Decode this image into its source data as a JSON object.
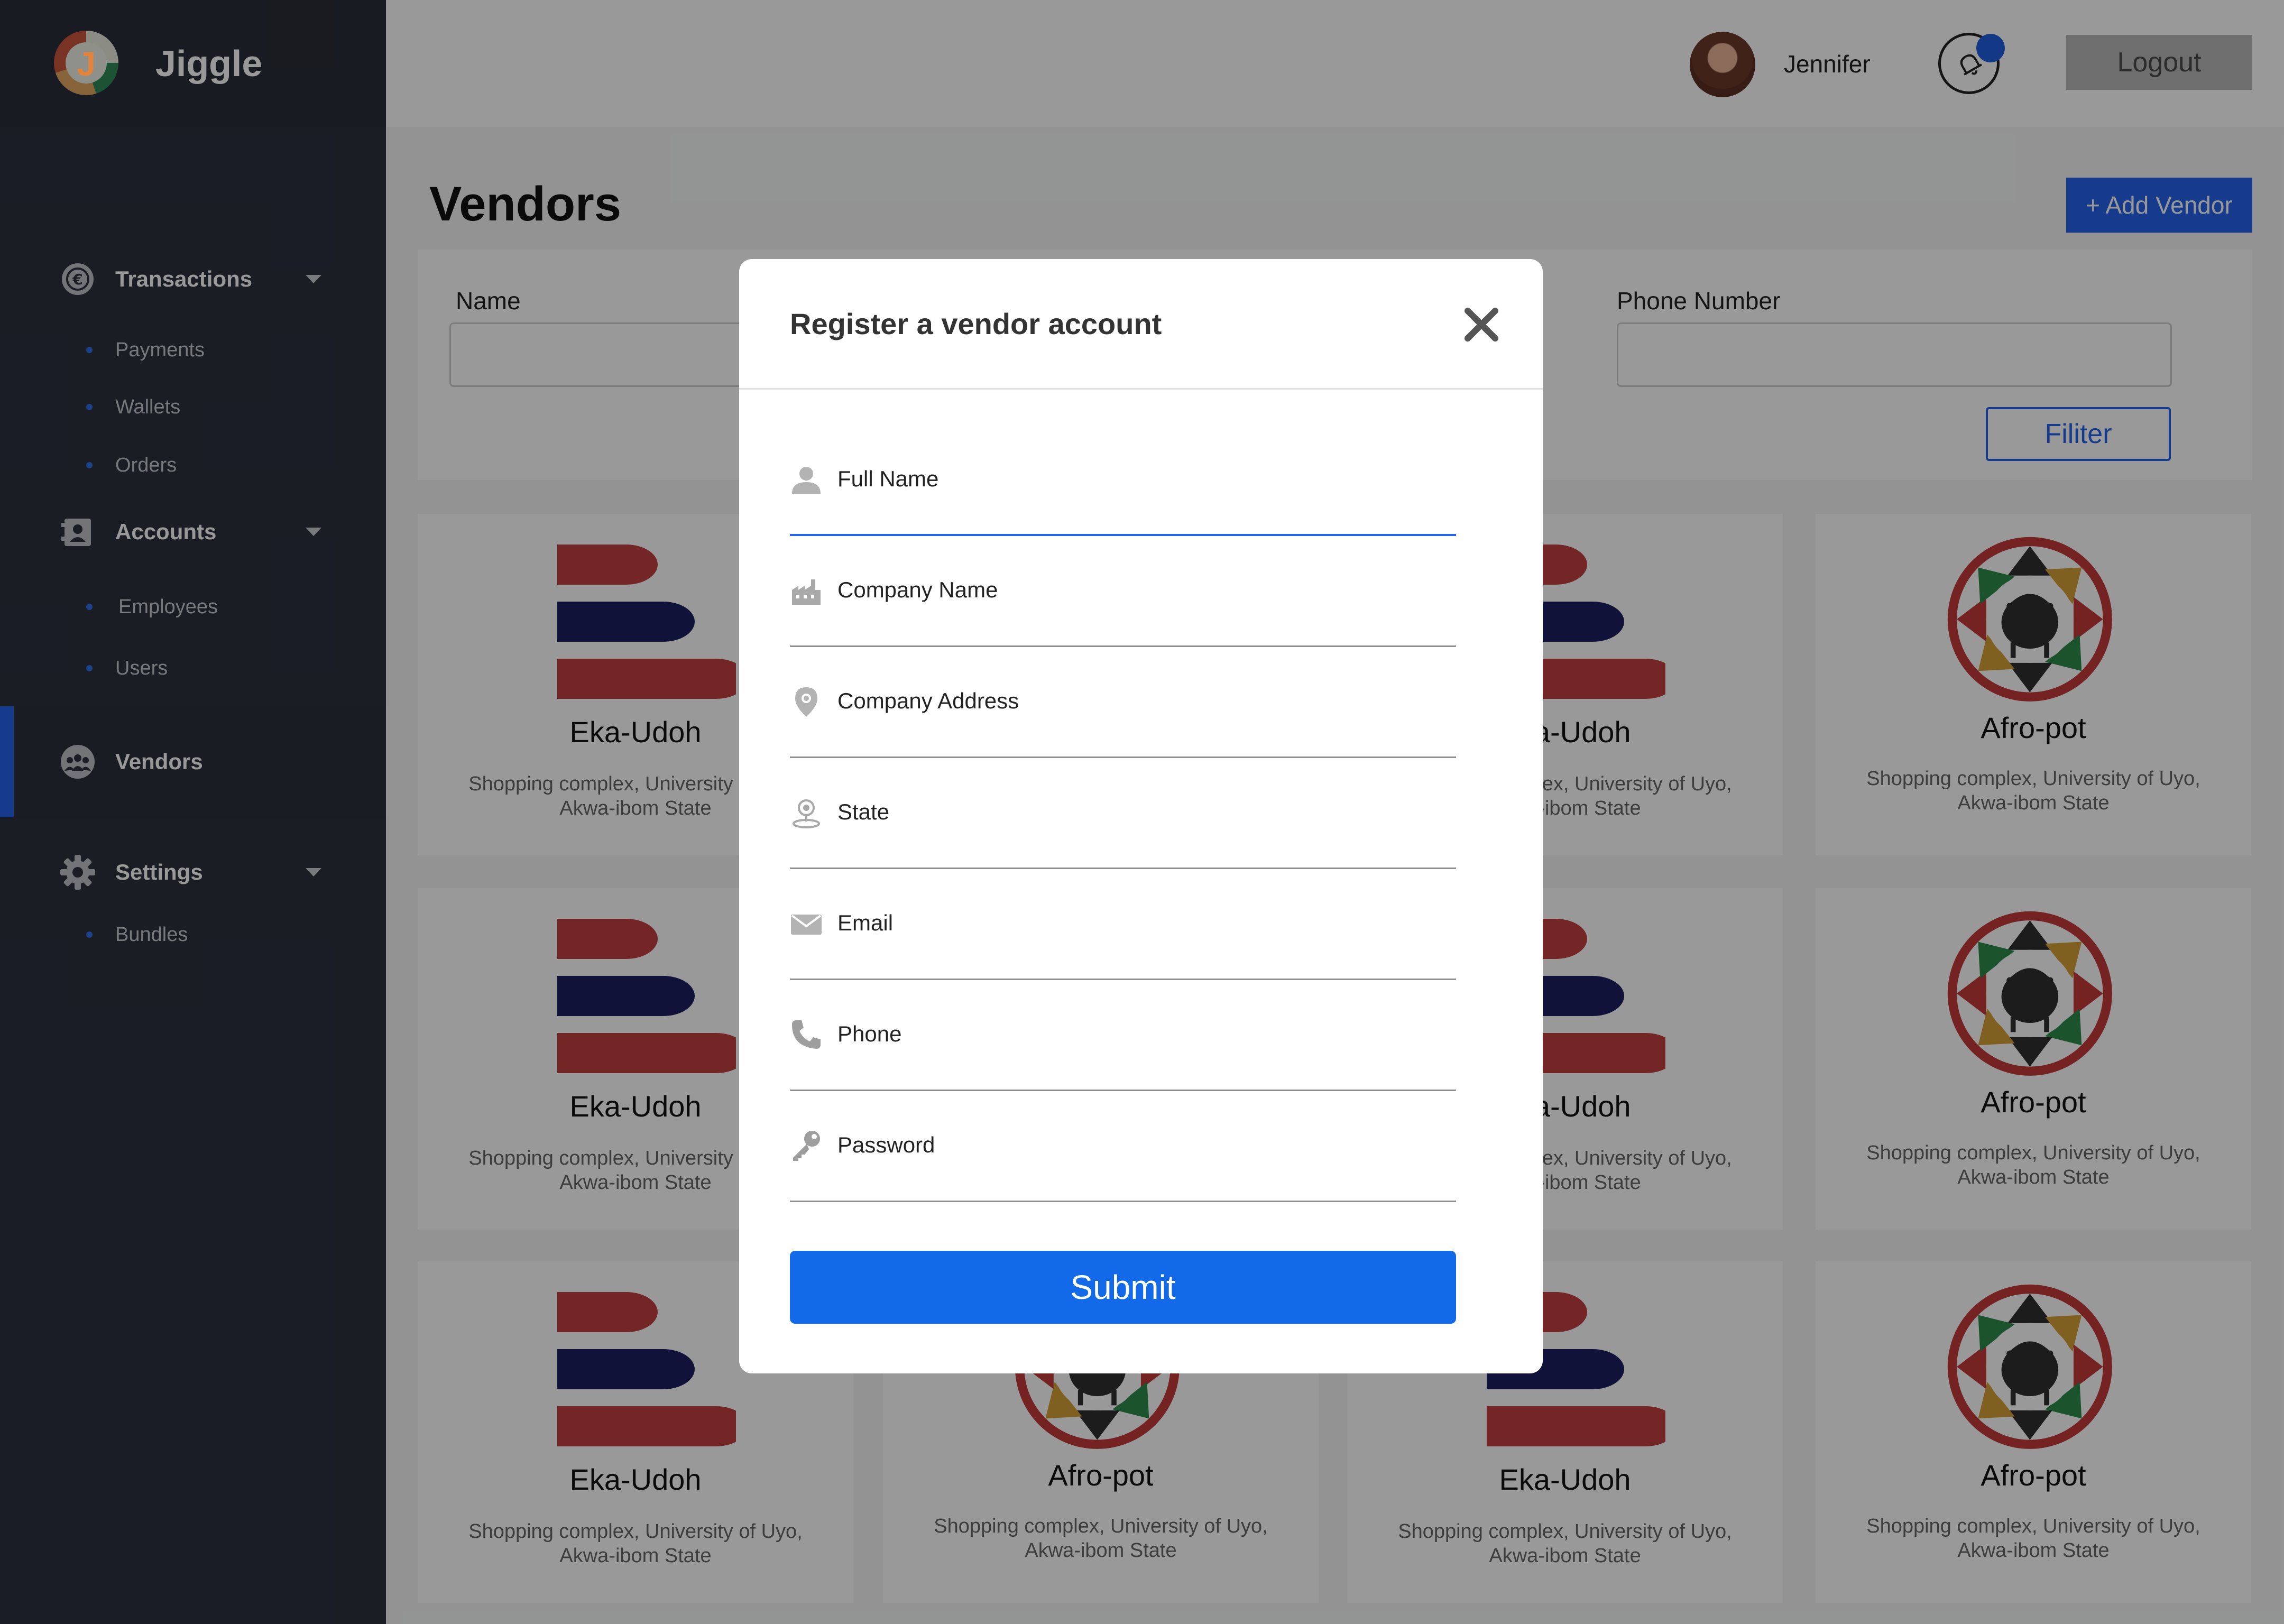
{
  "app": {
    "brand_name": "Jiggle",
    "brand_letter": "J"
  },
  "sidebar": {
    "sections": [
      {
        "label": "Transactions",
        "icon": "currency-icon",
        "items": [
          "Payments",
          "Wallets",
          "Orders"
        ]
      },
      {
        "label": "Accounts",
        "icon": "contacts-icon",
        "items": [
          "Employees",
          "Users"
        ]
      },
      {
        "label": "Vendors",
        "icon": "group-icon",
        "active": true,
        "items": []
      },
      {
        "label": "Settings",
        "icon": "gear-icon",
        "items": [
          "Bundles"
        ]
      }
    ]
  },
  "header": {
    "user_name": "Jennifer",
    "logout_label": "Logout",
    "notification_icon": "bell-icon"
  },
  "page": {
    "title": "Vendors",
    "add_button": "+ Add Vendor"
  },
  "filters": {
    "name_label": "Name",
    "phone_label": "Phone Number",
    "filter_button": "Filiter"
  },
  "vendors": [
    {
      "name": "Eka-Udoh",
      "address_line1": "Shopping complex, University of Uyo,",
      "address_line2": "Akwa-ibom State",
      "logo": "stacked-pills-logo"
    },
    {
      "name": "Afro-pot",
      "address_line1": "Shopping complex, University of Uyo,",
      "address_line2": "Akwa-ibom State",
      "logo": "pot-logo"
    },
    {
      "name": "Eka-Udoh",
      "address_line1": "Shopping complex, University of Uyo,",
      "address_line2": "Akwa-ibom State",
      "logo": "stacked-pills-logo"
    },
    {
      "name": "Afro-pot",
      "address_line1": "Shopping complex, University of Uyo,",
      "address_line2": "Akwa-ibom State",
      "logo": "pot-logo"
    }
  ],
  "modal": {
    "title": "Register a vendor account",
    "fields": [
      {
        "label": "Full Name",
        "icon": "person-icon"
      },
      {
        "label": "Company Name",
        "icon": "factory-icon"
      },
      {
        "label": "Company Address",
        "icon": "location-pin-icon"
      },
      {
        "label": "State",
        "icon": "map-marker-icon"
      },
      {
        "label": "Email",
        "icon": "envelope-icon"
      },
      {
        "label": "Phone",
        "icon": "phone-icon"
      },
      {
        "label": "Password",
        "icon": "key-icon"
      }
    ],
    "submit_label": "Submit"
  },
  "colors": {
    "accent": "#2563eb",
    "sidebar": "#2c313d",
    "submit": "#136ae8",
    "notification_dot": "#1f5ee0"
  }
}
